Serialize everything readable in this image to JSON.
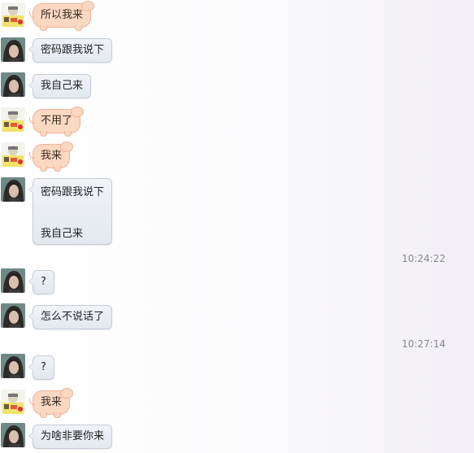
{
  "messages": [
    {
      "sender": "girl",
      "text": "所以我来"
    },
    {
      "sender": "boy",
      "text": "密码跟我说下"
    },
    {
      "sender": "boy",
      "text": "我自己来"
    },
    {
      "sender": "girl",
      "text": "不用了"
    },
    {
      "sender": "girl",
      "text": "我来"
    },
    {
      "sender": "boy",
      "lines": [
        "密码跟我说下",
        "我自己来"
      ]
    },
    {
      "type": "time",
      "text": "10:24:22"
    },
    {
      "sender": "boy",
      "text": "?"
    },
    {
      "sender": "boy",
      "text": "怎么不说话了"
    },
    {
      "type": "time",
      "text": "10:27:14"
    },
    {
      "sender": "boy",
      "text": "?"
    },
    {
      "sender": "girl",
      "text": "我来"
    },
    {
      "sender": "boy",
      "text": "为啥非要你来"
    }
  ],
  "colors": {
    "boy_bubble": "#e6ebf1",
    "girl_bubble": "#fbd8c2",
    "timestamp": "#888888"
  },
  "icons": {
    "girl_avatar": "cartoon-avatar-icon",
    "boy_avatar": "portrait-avatar-icon"
  }
}
